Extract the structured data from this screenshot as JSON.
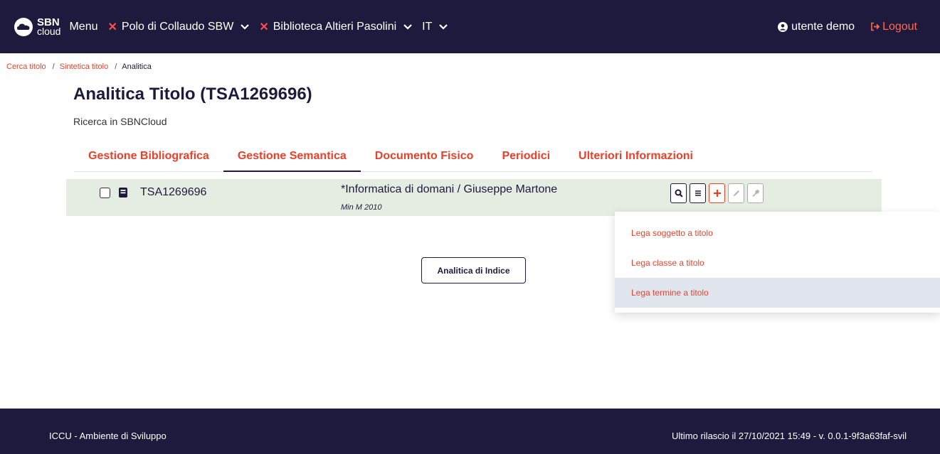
{
  "navbar": {
    "logo_line1": "SBN",
    "logo_line2": "cloud",
    "menu_label": "Menu",
    "polo_label": "Polo di Collaudo SBW",
    "biblioteca_label": "Biblioteca Altieri Pasolini",
    "lang_label": "IT",
    "user_label": "utente demo",
    "logout_label": "Logout",
    "accent_color": "#ff4d4d"
  },
  "breadcrumb": {
    "items": [
      "Cerca titolo",
      "Sintetica titolo",
      "Analitica"
    ],
    "separator": "/"
  },
  "page": {
    "title": "Analitica Titolo (TSA1269696)",
    "subtitle": "Ricerca in SBNCloud"
  },
  "tabs": [
    {
      "label": "Gestione Bibliografica",
      "active": false
    },
    {
      "label": "Gestione Semantica",
      "active": true
    },
    {
      "label": "Documento Fisico",
      "active": false
    },
    {
      "label": "Periodici",
      "active": false
    },
    {
      "label": "Ulteriori Informazioni",
      "active": false
    }
  ],
  "result": {
    "id": "TSA1269696",
    "title": "*Informatica di domani / Giuseppe Martone",
    "meta": "Min M 2010",
    "actions": [
      "search-icon",
      "list-icon",
      "plus-icon",
      "pencil-icon",
      "wrench-icon"
    ]
  },
  "buttons": {
    "indice_label": "Analitica di Indice"
  },
  "dropdown": {
    "items": [
      "Lega soggetto a titolo",
      "Lega classe a titolo",
      "Lega termine a titolo"
    ],
    "highlighted_index": 2
  },
  "footer": {
    "left": "ICCU - Ambiente di Sviluppo",
    "right": "Ultimo rilascio il 27/10/2021 15:49 - v. 0.0.1-9f3a63faf-svil"
  },
  "colors": {
    "navy": "#1e1a3d",
    "accent": "#e6422b",
    "row_bg": "#e5ede3"
  }
}
